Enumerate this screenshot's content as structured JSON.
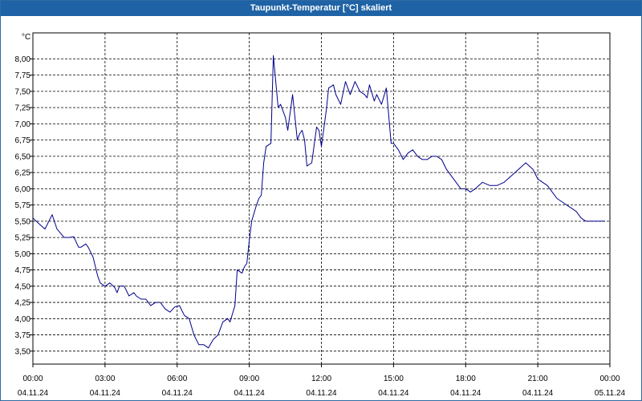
{
  "window": {
    "title": "Taupunkt-Temperatur [°C] skaliert"
  },
  "chart_data": {
    "type": "line",
    "title": "Taupunkt-Temperatur [°C] skaliert",
    "ylabel": "°C",
    "xlabel": "",
    "ylim": [
      3.3,
      8.4
    ],
    "xlim_hours": [
      0,
      24
    ],
    "grid": true,
    "y_ticks": [
      "3,50",
      "3,75",
      "4,00",
      "4,25",
      "4,50",
      "4,75",
      "5,00",
      "5,25",
      "5,50",
      "5,75",
      "6,00",
      "6,25",
      "6,50",
      "6,75",
      "7,00",
      "7,25",
      "7,50",
      "7,75",
      "8,00"
    ],
    "x_ticks": [
      {
        "time": "00:00",
        "date": "04.11.24"
      },
      {
        "time": "03:00",
        "date": "04.11.24"
      },
      {
        "time": "06:00",
        "date": "04.11.24"
      },
      {
        "time": "09:00",
        "date": "04.11.24"
      },
      {
        "time": "12:00",
        "date": "04.11.24"
      },
      {
        "time": "15:00",
        "date": "04.11.24"
      },
      {
        "time": "18:00",
        "date": "04.11.24"
      },
      {
        "time": "21:00",
        "date": "04.11.24"
      },
      {
        "time": "00:00",
        "date": "05.11.24"
      }
    ],
    "series": [
      {
        "color": "#00008b",
        "x": [
          0.0,
          0.2,
          0.5,
          0.8,
          1.0,
          1.3,
          1.5,
          1.7,
          1.9,
          2.0,
          2.2,
          2.3,
          2.5,
          2.7,
          2.8,
          3.0,
          3.2,
          3.4,
          3.5,
          3.6,
          3.8,
          4.0,
          4.2,
          4.3,
          4.5,
          4.7,
          4.9,
          5.1,
          5.3,
          5.5,
          5.7,
          5.9,
          6.1,
          6.3,
          6.5,
          6.7,
          6.9,
          7.1,
          7.3,
          7.5,
          7.7,
          7.9,
          8.1,
          8.2,
          8.4,
          8.5,
          8.7,
          8.8,
          8.9,
          9.0,
          9.1,
          9.3,
          9.4,
          9.5,
          9.6,
          9.7,
          9.9,
          10.0,
          10.2,
          10.3,
          10.5,
          10.6,
          10.8,
          11.0,
          11.1,
          11.2,
          11.3,
          11.4,
          11.6,
          11.8,
          11.9,
          12.0,
          12.2,
          12.3,
          12.5,
          12.6,
          12.8,
          13.0,
          13.2,
          13.4,
          13.6,
          13.8,
          13.9,
          14.0,
          14.2,
          14.3,
          14.5,
          14.7,
          14.9,
          15.0,
          15.2,
          15.4,
          15.6,
          15.8,
          16.0,
          16.2,
          16.4,
          16.6,
          16.8,
          17.0,
          17.2,
          17.4,
          17.6,
          17.8,
          18.0,
          18.2,
          18.4,
          18.7,
          19.0,
          19.3,
          19.6,
          19.9,
          20.2,
          20.5,
          20.8,
          21.0,
          21.2,
          21.4,
          21.6,
          21.8,
          22.0,
          22.2,
          22.4,
          22.6,
          22.8,
          23.0,
          23.2,
          23.4,
          23.6,
          23.8
        ],
        "y": [
          5.55,
          5.48,
          5.38,
          5.6,
          5.38,
          5.25,
          5.25,
          5.26,
          5.1,
          5.1,
          5.15,
          5.1,
          4.95,
          4.65,
          4.55,
          4.5,
          4.55,
          4.48,
          4.4,
          4.5,
          4.5,
          4.35,
          4.4,
          4.35,
          4.3,
          4.3,
          4.2,
          4.25,
          4.25,
          4.15,
          4.1,
          4.18,
          4.2,
          4.05,
          4.0,
          3.75,
          3.6,
          3.6,
          3.55,
          3.68,
          3.75,
          3.95,
          4.0,
          3.95,
          4.2,
          4.75,
          4.7,
          4.8,
          4.85,
          5.2,
          5.5,
          5.75,
          5.85,
          5.9,
          6.4,
          6.65,
          6.7,
          8.05,
          7.25,
          7.3,
          7.1,
          6.9,
          7.45,
          6.75,
          6.85,
          6.9,
          6.75,
          6.35,
          6.4,
          6.95,
          6.9,
          6.65,
          7.2,
          7.55,
          7.6,
          7.45,
          7.3,
          7.65,
          7.45,
          7.65,
          7.5,
          7.45,
          7.4,
          7.6,
          7.35,
          7.45,
          7.3,
          7.55,
          6.7,
          6.7,
          6.6,
          6.45,
          6.55,
          6.6,
          6.5,
          6.45,
          6.45,
          6.5,
          6.5,
          6.45,
          6.3,
          6.2,
          6.1,
          6.0,
          6.0,
          5.95,
          6.0,
          6.1,
          6.05,
          6.05,
          6.1,
          6.2,
          6.3,
          6.4,
          6.3,
          6.15,
          6.1,
          6.05,
          5.95,
          5.85,
          5.8,
          5.75,
          5.7,
          5.65,
          5.55,
          5.5,
          5.5,
          5.5,
          5.5,
          5.5
        ]
      }
    ]
  }
}
